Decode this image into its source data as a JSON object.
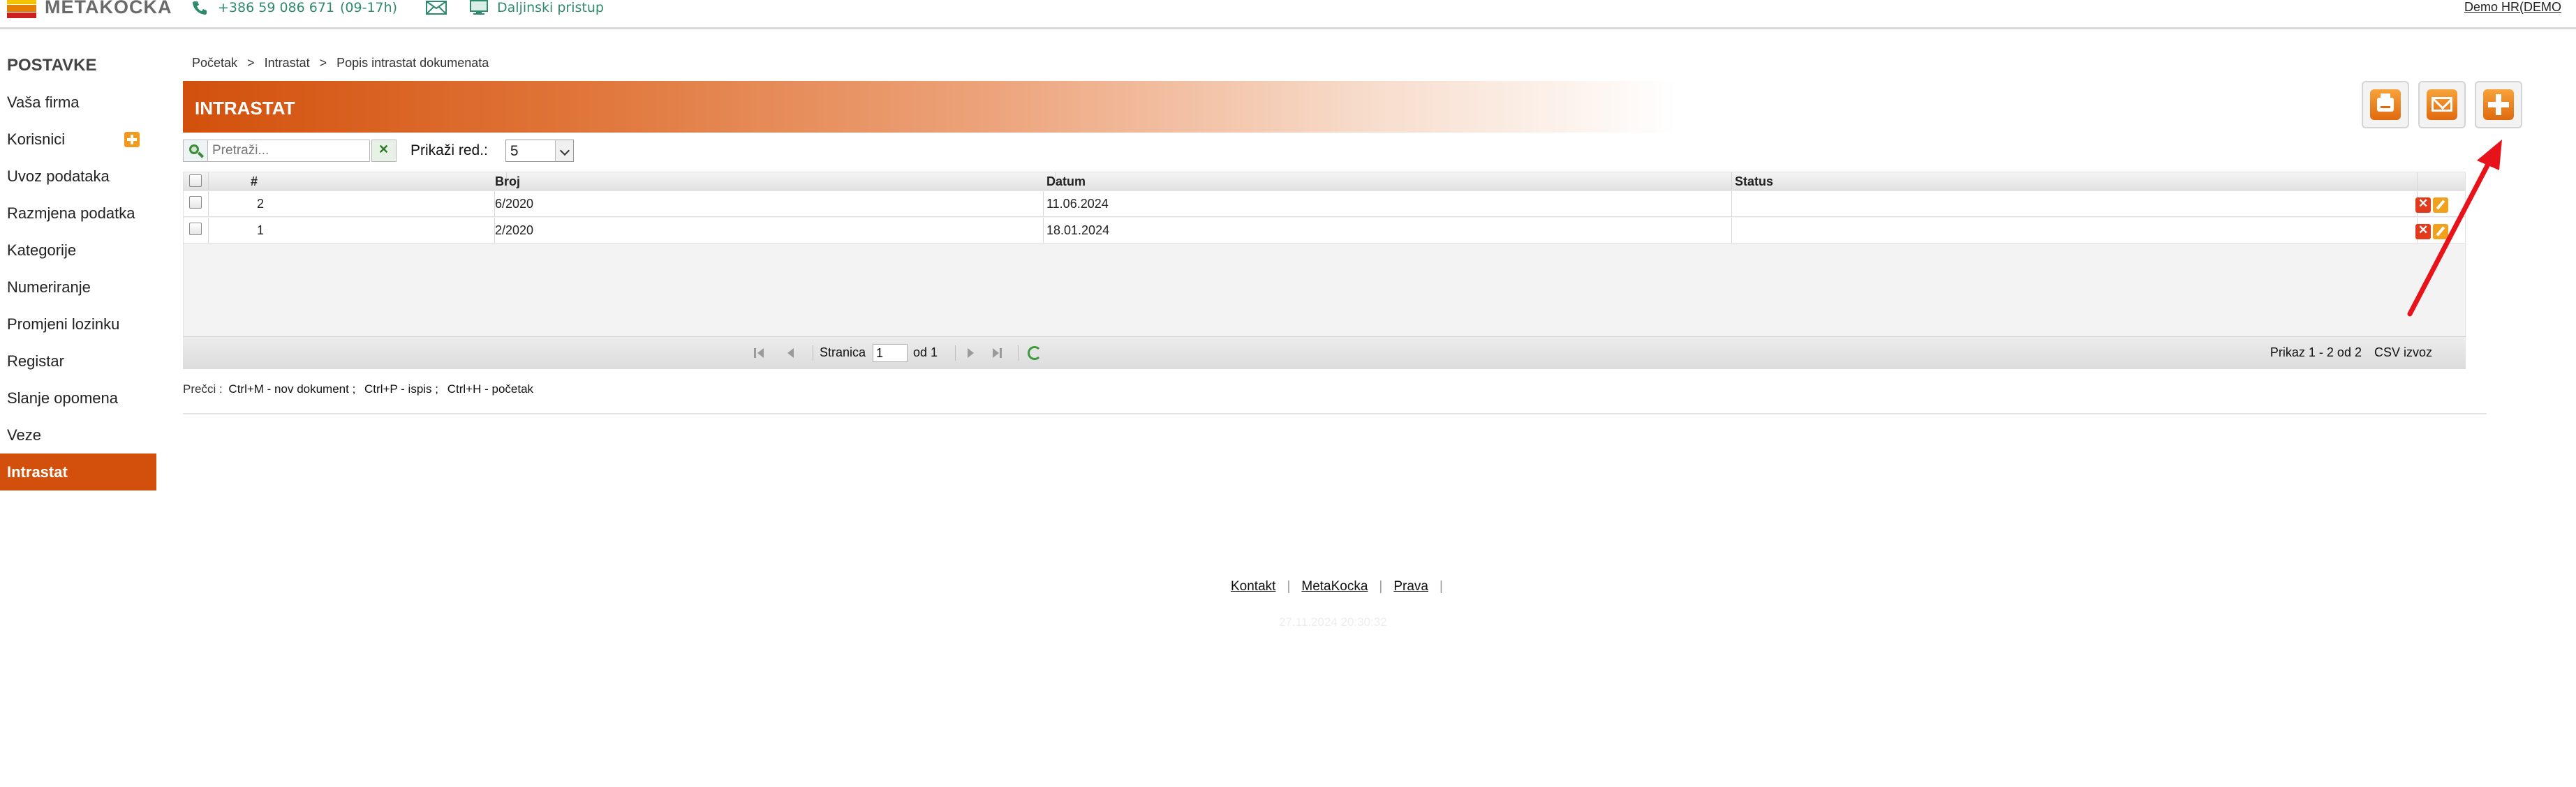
{
  "topbar": {
    "logo_text": "METAKOCKA",
    "phone": "+386 59 086 671",
    "phone_hours": "(09-17h)",
    "remote_label": "Daljinski pristup",
    "user": "Demo HR(DEMO"
  },
  "sidebar": {
    "title": "POSTAVKE",
    "items": [
      {
        "label": "Vaša firma"
      },
      {
        "label": "Korisnici"
      },
      {
        "label": "Uvoz podataka"
      },
      {
        "label": "Razmjena podatka"
      },
      {
        "label": "Kategorije"
      },
      {
        "label": "Numeriranje"
      },
      {
        "label": "Promjeni lozinku"
      },
      {
        "label": "Registar"
      },
      {
        "label": "Slanje opomena"
      },
      {
        "label": "Veze"
      },
      {
        "label": "Intrastat"
      }
    ],
    "active_item": "Intrastat"
  },
  "breadcrumb": {
    "items": [
      "Početak",
      "Intrastat",
      "Popis intrastat dokumenata"
    ],
    "separator": ">"
  },
  "page": {
    "title": "INTRASTAT"
  },
  "toolbar": {
    "print_icon": "printer-icon",
    "mail_icon": "envelope-icon",
    "add_icon": "plus-icon"
  },
  "search": {
    "placeholder": "Pretraži...",
    "value": "",
    "rows_label": "Prikaži red.:",
    "rows_value": "5"
  },
  "grid": {
    "columns": [
      "#",
      "Broj",
      "Datum",
      "Status"
    ],
    "rows": [
      {
        "num": "2",
        "broj": "6/2020",
        "datum": "11.06.2024",
        "status": ""
      },
      {
        "num": "1",
        "broj": "2/2020",
        "datum": "18.01.2024",
        "status": ""
      }
    ]
  },
  "pager": {
    "page_label": "Stranica",
    "page_value": "1",
    "of_label": "od 1",
    "summary": "Prikaz 1 - 2 od 2",
    "csv": "CSV izvoz"
  },
  "shortcuts": {
    "label": "Prečci :",
    "items": [
      "Ctrl+M - nov dokument ;",
      "Ctrl+P - ispis ;",
      "Ctrl+H - početak"
    ]
  },
  "footer": {
    "links": [
      "Kontakt",
      "MetaKocka",
      "Prava"
    ],
    "separator": "|",
    "timestamp": "27.11.2024 20:30:32"
  },
  "colors": {
    "accent": "#d2500c",
    "contact_text": "#2e8a6c",
    "annotation_arrow": "#e8121a"
  }
}
